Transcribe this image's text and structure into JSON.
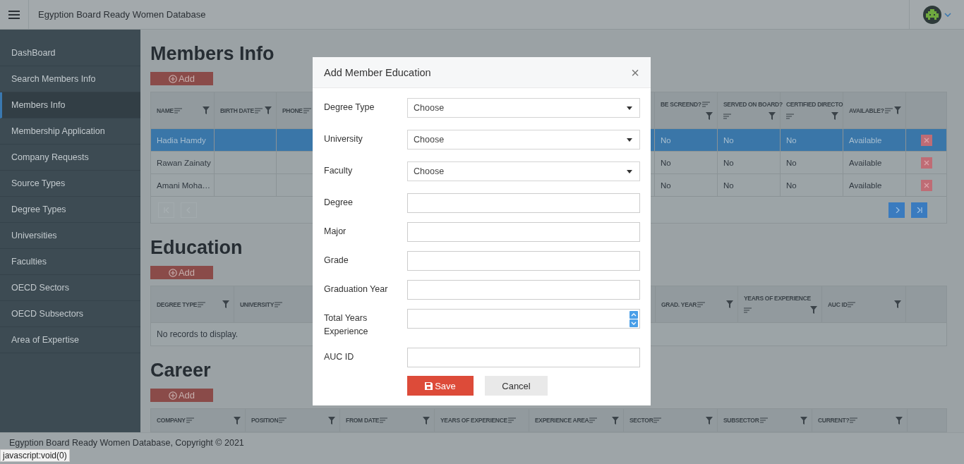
{
  "header": {
    "title": "Egyption Board Ready Women Database"
  },
  "sidebar": {
    "items": [
      {
        "label": "DashBoard",
        "selected": false
      },
      {
        "label": "Search Members Info",
        "selected": false
      },
      {
        "label": "Members Info",
        "selected": true
      },
      {
        "label": "Membership Application",
        "selected": false
      },
      {
        "label": "Company Requests",
        "selected": false
      },
      {
        "label": "Source Types",
        "selected": false
      },
      {
        "label": "Degree Types",
        "selected": false
      },
      {
        "label": "Universities",
        "selected": false
      },
      {
        "label": "Faculties",
        "selected": false
      },
      {
        "label": "OECD Sectors",
        "selected": false
      },
      {
        "label": "OECD Subsectors",
        "selected": false
      },
      {
        "label": "Area of Expertise",
        "selected": false
      }
    ]
  },
  "members": {
    "title": "Members Info",
    "add_button": "Add",
    "columns": [
      {
        "label": "NAME",
        "filter": true
      },
      {
        "label": "BIRTH DATE",
        "filter": true
      },
      {
        "label": "PHONE",
        "filter": false
      },
      {
        "label": "BE SCREEND?",
        "filter": true
      },
      {
        "label": "SERVED ON BOARD?",
        "filter": true
      },
      {
        "label": "CERTIFIED DIRECTO",
        "filter": true
      },
      {
        "label": "AVAILABLE?",
        "filter": true
      }
    ],
    "rows": [
      {
        "name": "Hadia Hamdy",
        "be_screened": "No",
        "served_on_board": "No",
        "certified_director": "No",
        "available": "Available",
        "selected": true
      },
      {
        "name": "Rawan Zainaty",
        "be_screened": "No",
        "served_on_board": "No",
        "certified_director": "No",
        "available": "Available",
        "selected": false
      },
      {
        "name": "Amani Moha…",
        "be_screened": "No",
        "served_on_board": "No",
        "certified_director": "No",
        "available": "Available",
        "selected": false
      }
    ],
    "pager": [
      {
        "kind": "first",
        "disabled": true
      },
      {
        "kind": "prev",
        "disabled": true
      },
      {
        "kind": "next",
        "disabled": false
      },
      {
        "kind": "last",
        "disabled": false
      }
    ]
  },
  "education": {
    "title": "Education",
    "add_button": "Add",
    "columns": [
      {
        "label": "DEGREE TYPE",
        "filter": true
      },
      {
        "label": "UNIVERSITY",
        "filter": false
      },
      {
        "label": "GRAD. YEAR",
        "filter": true
      },
      {
        "label": "YEARS OF EXPERIENCE",
        "filter": true
      },
      {
        "label": "AUC ID",
        "filter": true
      }
    ],
    "empty_text": "No records to display."
  },
  "career": {
    "title": "Career",
    "add_button": "Add",
    "columns": [
      {
        "label": "COMPANY",
        "filter": true
      },
      {
        "label": "POSITION",
        "filter": true
      },
      {
        "label": "FROM DATE",
        "filter": true
      },
      {
        "label": "YEARS OF EXPERIENCE",
        "filter": false
      },
      {
        "label": "EXPERIENCE AREA",
        "filter": true
      },
      {
        "label": "SECTOR",
        "filter": true
      },
      {
        "label": "SUBSECTOR",
        "filter": true
      },
      {
        "label": "CURRENT?",
        "filter": true
      }
    ]
  },
  "footer": {
    "text": "Egyption Board Ready Women Database, Copyright © 2021"
  },
  "status_text": "javascript:void(0)",
  "modal": {
    "title": "Add Member Education",
    "close": "×",
    "fields": [
      {
        "label": "Degree Type",
        "kind": "select",
        "value": "Choose"
      },
      {
        "label": "University",
        "kind": "select",
        "value": "Choose"
      },
      {
        "label": "Faculty",
        "kind": "select",
        "value": "Choose"
      },
      {
        "label": "Degree",
        "kind": "text"
      },
      {
        "label": "Major",
        "kind": "text"
      },
      {
        "label": "Grade",
        "kind": "text"
      },
      {
        "label": "Graduation Year",
        "kind": "text"
      },
      {
        "label": "Total Years Experience",
        "kind": "number"
      },
      {
        "label": "AUC ID",
        "kind": "text"
      }
    ],
    "save": "Save",
    "cancel": "Cancel"
  }
}
